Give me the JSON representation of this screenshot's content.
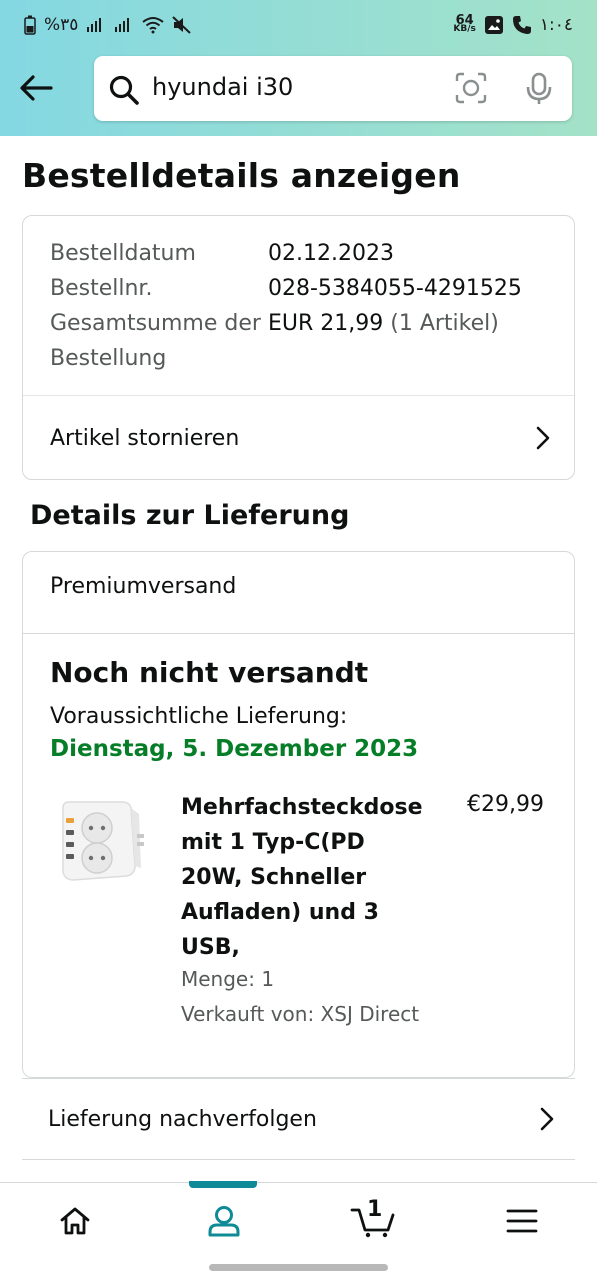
{
  "status_bar": {
    "battery_percent": "%٣٥",
    "net_speed_value": "64",
    "net_speed_unit": "KB/s",
    "time": "١:٠٤"
  },
  "search": {
    "query": "hyundai i30",
    "icons": [
      "back-arrow-icon",
      "search-icon",
      "camera-lens-icon",
      "microphone-icon"
    ]
  },
  "page": {
    "title": "Bestelldetails anzeigen"
  },
  "order_summary": {
    "date_label": "Bestelldatum",
    "date_value": "02.12.2023",
    "number_label": "Bestellnr.",
    "number_value": "028-5384055-4291525",
    "total_label": "Gesamtsumme der Bestellung",
    "total_value": "EUR 21,99",
    "total_items": "(1 Artikel)",
    "cancel_link": "Artikel stornieren"
  },
  "delivery": {
    "section_title": "Details zur Lieferung",
    "shipping_method": "Premiumversand",
    "status": "Noch nicht versandt",
    "expected_label": "Voraussichtliche Lieferung:",
    "expected_date": "Dienstag, 5. Dezember 2023",
    "product": {
      "title": "Mehrfachsteckdose mit 1 Typ-C(PD 20W, Schneller Aufladen) und 3 USB,",
      "price": "€29,99",
      "quantity": "Menge: 1",
      "seller": "Verkauft von: XSJ Direct"
    },
    "track_link": "Lieferung nachverfolgen"
  },
  "bottom_nav": {
    "items": [
      "home-icon",
      "account-icon",
      "cart-icon",
      "menu-icon"
    ],
    "active": "account-icon",
    "cart_count": "1"
  },
  "colors": {
    "header_gradient_start": "#84d8e2",
    "header_gradient_end": "#a4e2c8",
    "delivery_date": "#067d27",
    "active_tab": "#0f8a96",
    "muted_text": "#565959"
  }
}
